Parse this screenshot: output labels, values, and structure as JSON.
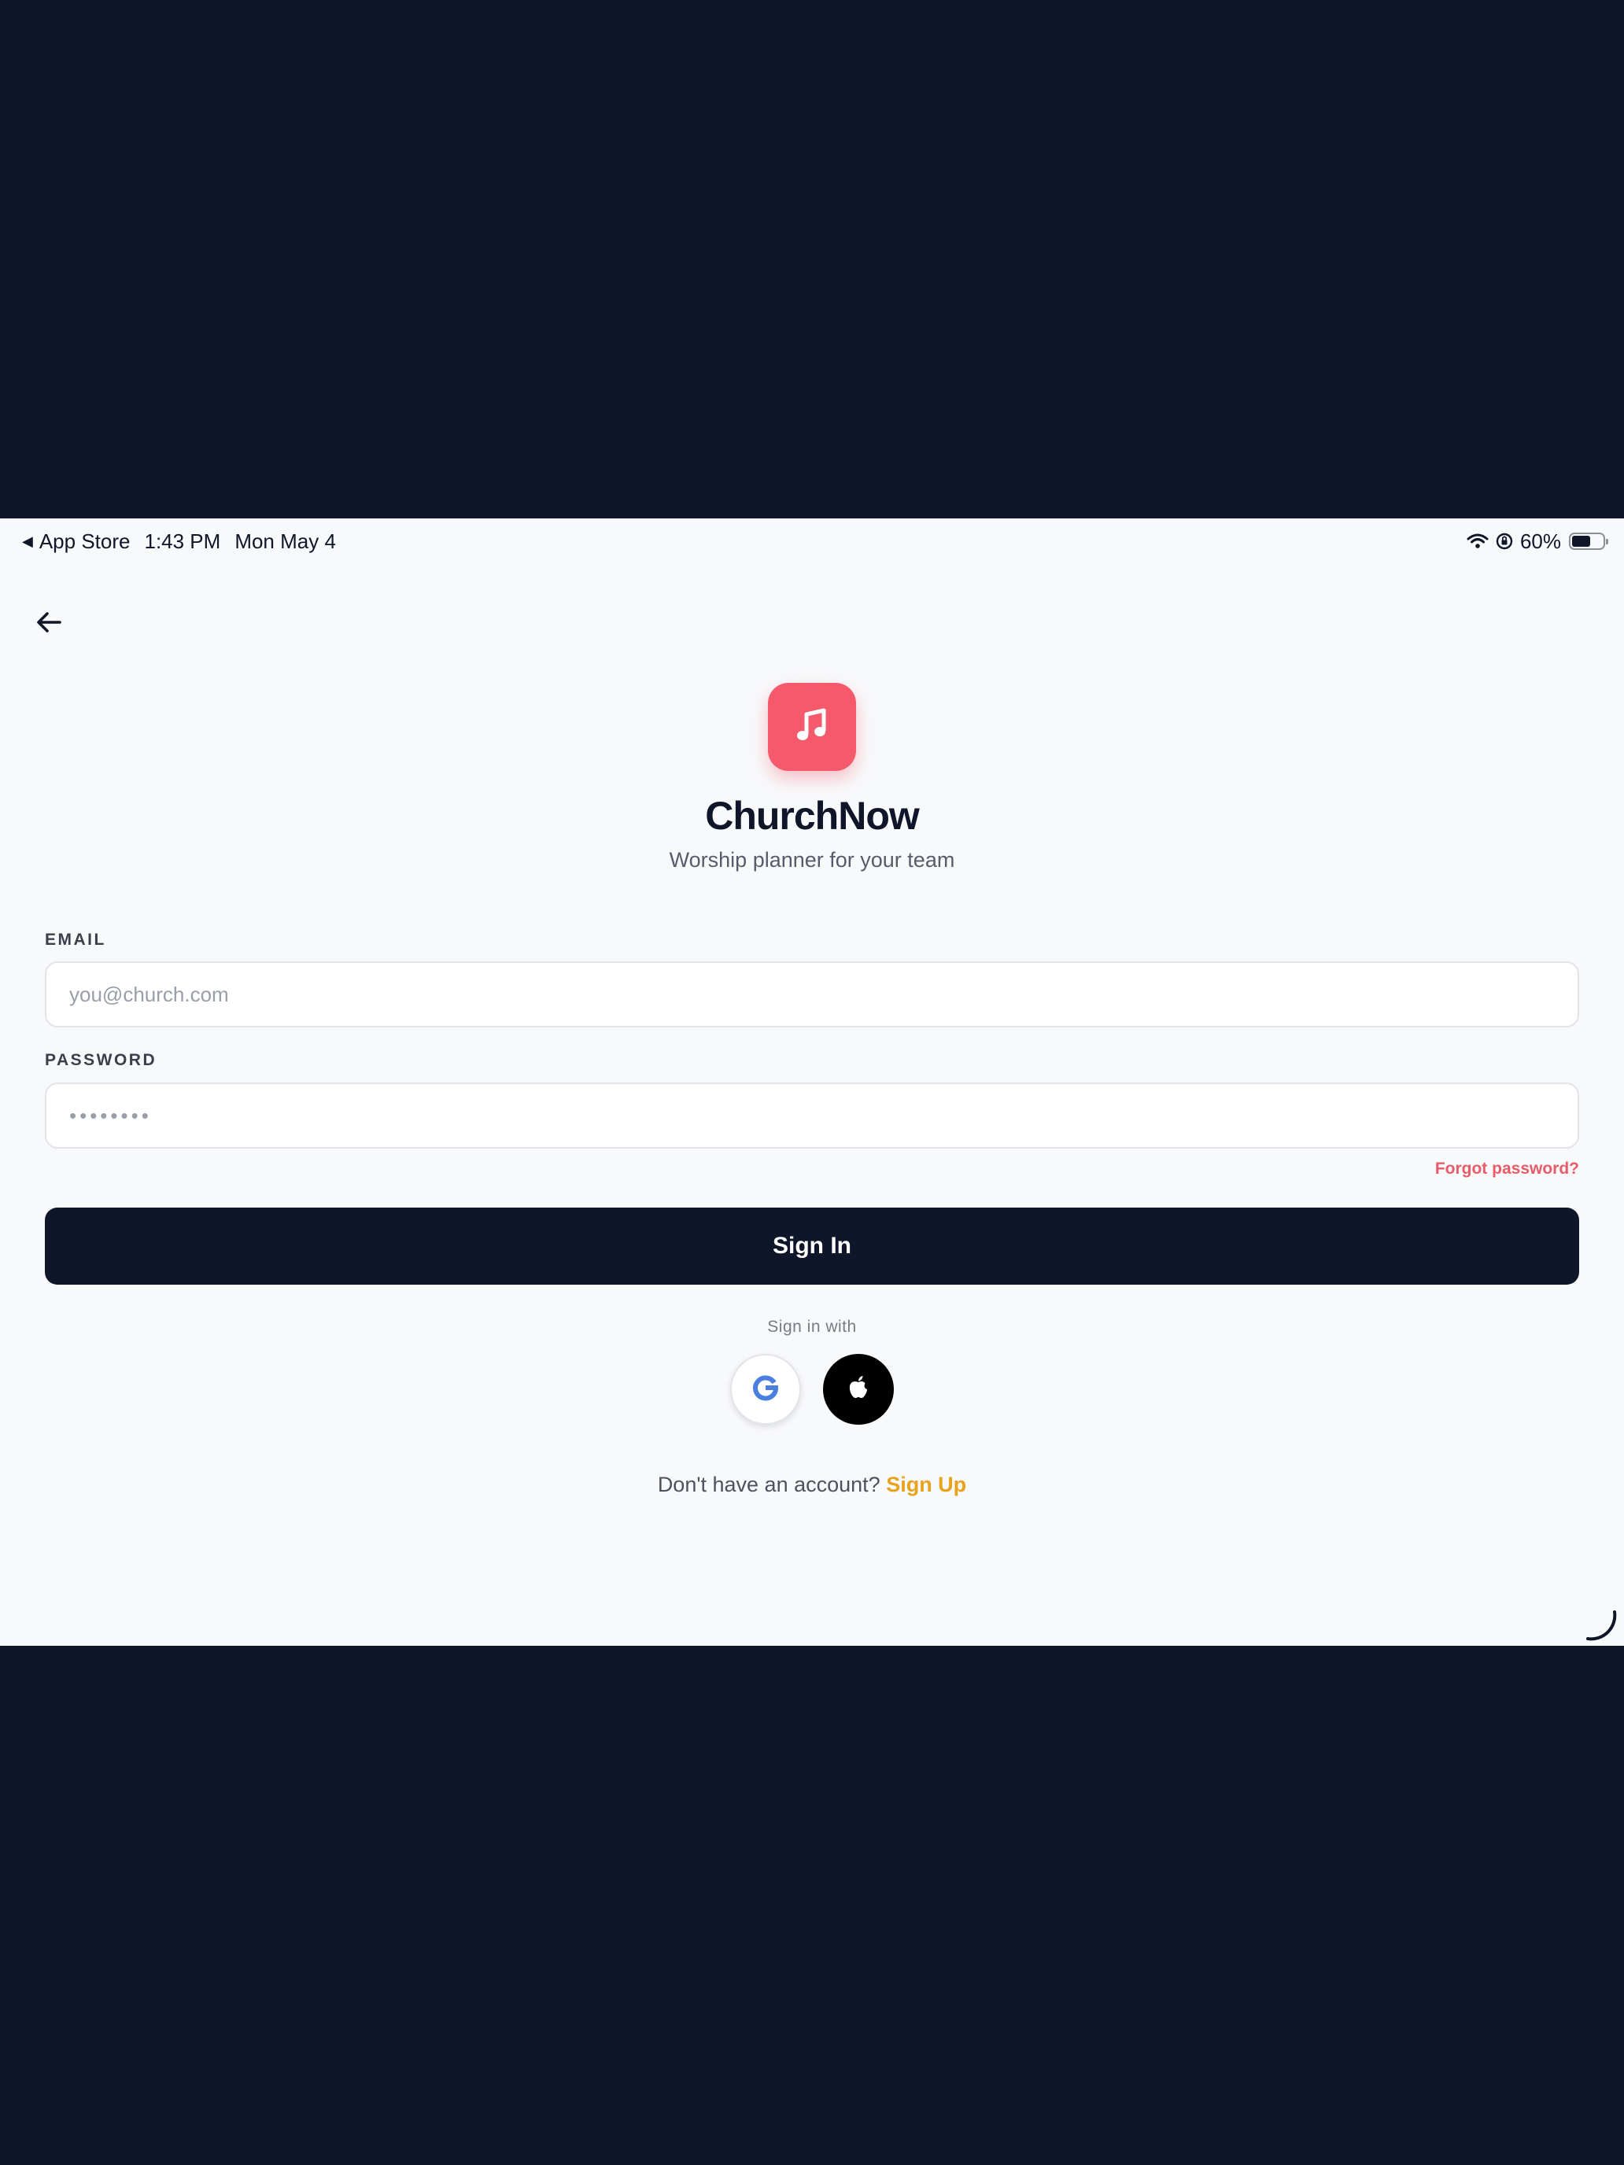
{
  "status_bar": {
    "back_app": "App Store",
    "time": "1:43 PM",
    "date": "Mon May 4",
    "battery": "60%",
    "battery_level": 0.6
  },
  "nav": {
    "back_icon": "arrow-left-icon"
  },
  "brand": {
    "icon": "music-note-icon",
    "title": "ChurchNow",
    "subtitle": "Worship planner for your team",
    "accent_color": "#f45a6b"
  },
  "form": {
    "email_label": "EMAIL",
    "email_placeholder": "you@church.com",
    "email_value": "",
    "password_label": "PASSWORD",
    "password_placeholder": "••••••••",
    "password_value": "",
    "forgot_label": "Forgot password?",
    "submit_label": "Sign In"
  },
  "social": {
    "heading": "Sign in with",
    "providers": [
      {
        "name": "google",
        "icon": "google-icon"
      },
      {
        "name": "apple",
        "icon": "apple-icon"
      }
    ]
  },
  "signup": {
    "prompt": "Don't have an account?",
    "link": "Sign Up",
    "link_color": "#e9a21b"
  },
  "colors": {
    "background": "#f8f9fb",
    "primary_dark": "#0f1629",
    "forgot_link": "#e85b69"
  }
}
